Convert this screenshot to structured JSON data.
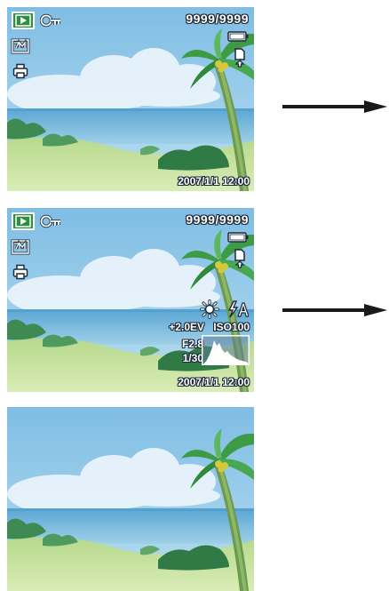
{
  "screens": [
    {
      "counter": "9999/9999",
      "datetime": "2007/1/1 12:00"
    },
    {
      "counter": "9999/9999",
      "datetime": "2007/1/1 12:00",
      "exposure_comp": "+2.0EV",
      "iso": "ISO100",
      "aperture": "F2.8",
      "shutter": "1/30"
    },
    {}
  ],
  "icons": {
    "playback": "playback-mode-icon",
    "protect": "protect-key-icon",
    "image_size": "image-size-7m-icon",
    "dpof": "dpof-print-icon",
    "battery": "battery-icon",
    "memory_card": "memory-card-icon",
    "white_balance": "white-balance-sun-icon",
    "flash": "flash-auto-icon",
    "histogram": "histogram-graph"
  },
  "colors": {
    "osd_green": "#2f8f3a",
    "sky": "#8fc6e6",
    "sea": "#6fb3d9",
    "grass": "#9cc97a",
    "arrow": "#1a1a1a"
  }
}
